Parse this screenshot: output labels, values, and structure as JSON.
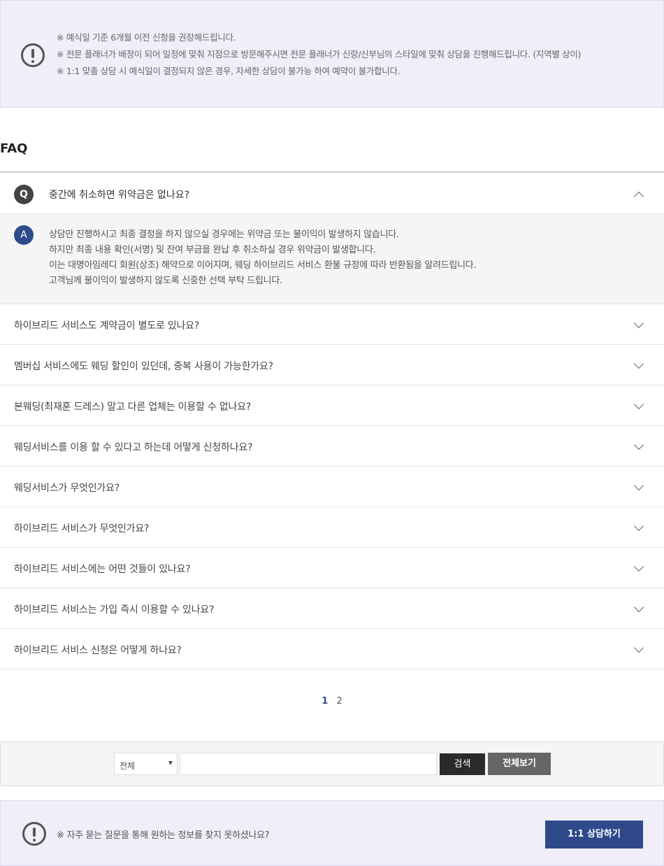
{
  "notice_top": {
    "icon": "exclamation-circle-icon",
    "lines": [
      "※ 예식일 기준 6개월 이전 신청을 권장해드립니다.",
      "※ 전문 플래너가 배정이 되어 일정에 맞춰 지점으로 방문해주시면 전문 플래너가 신랑/신부님의 스타일에 맞춰 상담을 진행해드립니다. (지역별 상이)",
      "※ 1:1 맞춤 상담 시 예식일이 결정되지 않은 경우, 자세한 상담이 불가능 하여 예약이 불가합니다."
    ]
  },
  "faq": {
    "title": "FAQ",
    "open": {
      "q_badge": "Q",
      "question": "중간에 취소하면 위약금은 없나요?",
      "a_badge": "A",
      "answer": [
        "상담만 진행하시고 최종 결정을 하지 않으실 경우에는 위약금 또는 불이익이 발생하지 않습니다.",
        "하지만 최종 내용 확인(서명) 및 잔여 부금을 완납 후 취소하실 경우 위약금이 발생합니다.",
        "이는 대명아임레디 회원(상조) 해약으로 이어지며, 웨딩 하이브리드 서비스 환불 규정에 따라 반환됨을 알려드립니다.",
        "고객님께 불이익이 발생하지 않도록 신중한 선택 부탁 드립니다."
      ]
    },
    "items": [
      "하이브리드 서비스도 계약금이 별도로 있나요?",
      "멤버십 서비스에도 웨딩 할인이 있던데, 중복 사용이 가능한가요?",
      "본웨딩(최재훈 드레스) 말고 다른 업체는 이용할 수 없나요?",
      "웨딩서비스를 이용 할 수 있다고 하는데 어떻게 신청하나요?",
      "웨딩서비스가 무엇인가요?",
      "하이브리드 서비스가 무엇인가요?",
      "하이브리드 서비스에는 어떤 것들이 있나요?",
      "하이브리드 서비스는 가입 즉시 이용할 수 있나요?",
      "하이브리드 서비스 신청은 어떻게 하나요?"
    ]
  },
  "pagination": {
    "pages": [
      "1",
      "2"
    ],
    "current": "1"
  },
  "search": {
    "select_value": "전체",
    "input_value": "",
    "search_label": "검색",
    "view_all_label": "전체보기"
  },
  "notice_bottom": {
    "icon": "exclamation-circle-icon",
    "text": "※ 자주 묻는 질문을 통해 원하는 정보를 찾지 못하셨나요?",
    "consult_label": "1:1 상담하기"
  },
  "colors": {
    "accent": "#2e4a8b",
    "notice_bg": "#efeef9",
    "dark_button": "#2a2a2a",
    "gray_button": "#666666"
  }
}
